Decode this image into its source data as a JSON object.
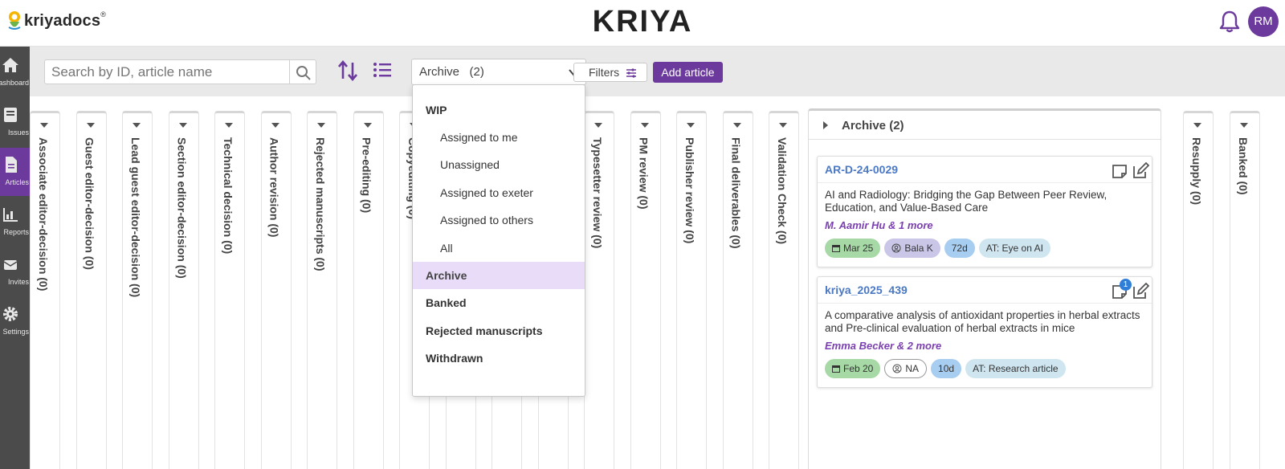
{
  "header": {
    "logo_text": "kriyadocs",
    "logo_mark": "®",
    "brand": "KRIYA",
    "avatar_initials": "RM",
    "colors": {
      "accent": "#6c3a9c",
      "link": "#4a78c4"
    }
  },
  "sidebar": {
    "items": [
      {
        "label": "Dashboard",
        "icon": "home-icon"
      },
      {
        "label": "Issues",
        "icon": "book-icon"
      },
      {
        "label": "Articles",
        "icon": "document-icon",
        "active": true
      },
      {
        "label": "Reports",
        "icon": "chart-icon"
      },
      {
        "label": "Invites",
        "icon": "invite-icon"
      },
      {
        "label": "Settings",
        "icon": "gear-icon"
      }
    ]
  },
  "toolbar": {
    "search_placeholder": "Search by ID, article name",
    "select_value": "Archive   (2)",
    "filters_label": "Filters",
    "add_label": "Add article"
  },
  "dropdown": {
    "items": [
      {
        "label": "WIP",
        "kind": "grp"
      },
      {
        "label": "Assigned to me",
        "kind": "sub"
      },
      {
        "label": "Unassigned",
        "kind": "sub"
      },
      {
        "label": "Assigned to exeter",
        "kind": "sub"
      },
      {
        "label": "Assigned to others",
        "kind": "sub"
      },
      {
        "label": "All",
        "kind": "sub"
      },
      {
        "label": "Archive",
        "kind": "selected"
      },
      {
        "label": "Banked",
        "kind": "grp"
      },
      {
        "label": "Rejected manuscripts",
        "kind": "grp"
      },
      {
        "label": "Withdrawn",
        "kind": "grp"
      }
    ]
  },
  "lanes": [
    "Associate editor-decision (0)",
    "Guest editor-decision (0)",
    "Lead guest editor-decision (0)",
    "Section editor-decision (0)",
    "Technical decision (0)",
    "Author revision (0)",
    "Rejected manuscripts (0)",
    "Pre-editing (0)",
    "Copyediting (0)",
    "",
    "",
    "",
    "Typesetter review (0)",
    "PM review (0)",
    "Publisher review (0)",
    "Final deliverables (0)",
    "Validation Check (0)"
  ],
  "right_lanes": [
    "Resupply (0)",
    "Banked (0)"
  ],
  "archive": {
    "title": "Archive (2)",
    "cards": [
      {
        "id": "AR-D-24-0029",
        "title": "AI and Radiology: Bridging the Gap Between Peer Review, Education, and Value-Based Care",
        "authors": "M. Aamir Hu & 1 more",
        "date": "Mar 25",
        "user": "Bala K",
        "days": "72d",
        "type": "AT: Eye on AI",
        "note_count": ""
      },
      {
        "id": "kriya_2025_439",
        "title": "A comparative analysis of antioxidant properties in herbal extracts and Pre-clinical evaluation of herbal extracts in mice",
        "authors": "Emma Becker & 2 more",
        "date": "Feb 20",
        "user": "NA",
        "days": "10d",
        "type": "AT: Research article",
        "note_count": "1"
      }
    ]
  }
}
